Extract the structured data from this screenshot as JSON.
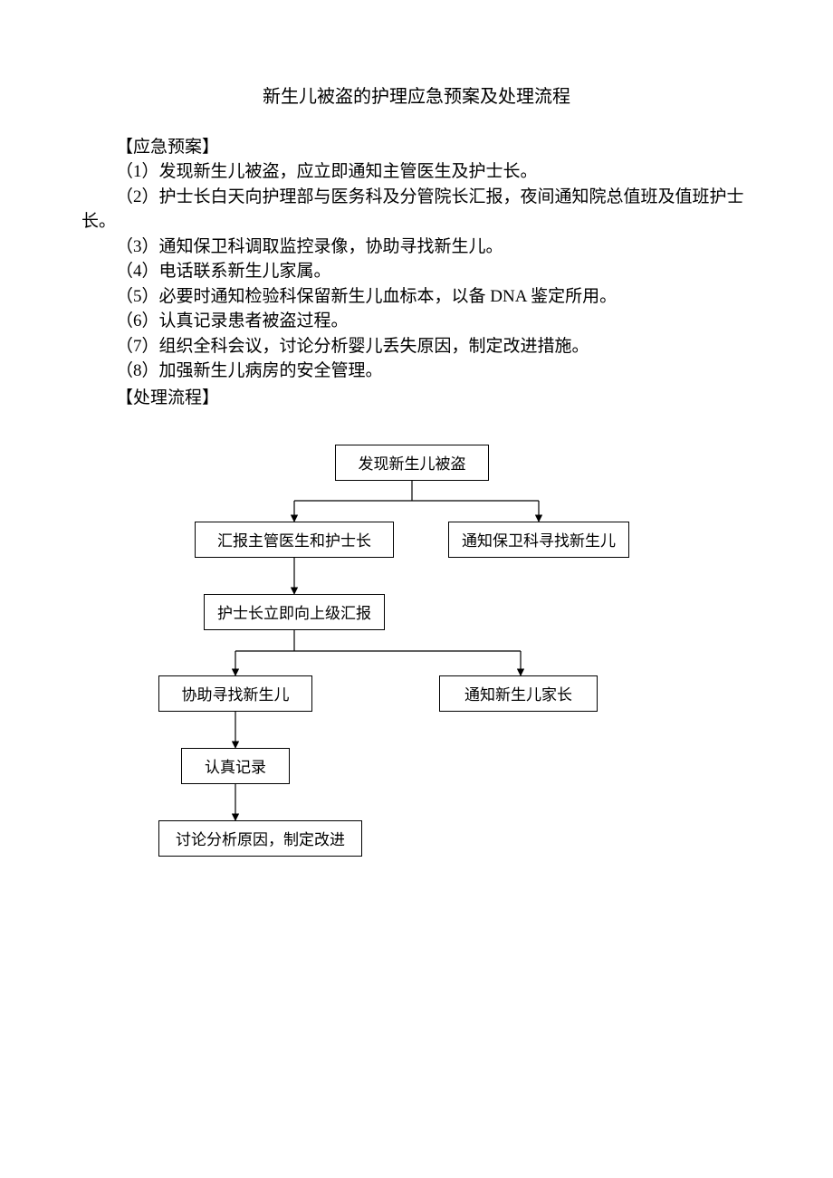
{
  "title": "新生儿被盗的护理应急预案及处理流程",
  "section1_label": "【应急预案】",
  "items": {
    "p1": "（1）发现新生儿被盗，应立即通知主管医生及护士长。",
    "p2": "（2）护士长白天向护理部与医务科及分管院长汇报，夜间通知院总值班及值班护士长。",
    "p3": "（3）通知保卫科调取监控录像，协助寻找新生儿。",
    "p4": "（4）电话联系新生儿家属。",
    "p5": "（5）必要时通知检验科保留新生儿血标本，以备 DNA 鉴定所用。",
    "p6": "（6）认真记录患者被盗过程。",
    "p7": "（7）组织全科会议，讨论分析婴儿丢失原因，制定改进措施。",
    "p8": "（8）加强新生儿病房的安全管理。"
  },
  "section2_label": "【处理流程】",
  "flow": {
    "b1": "发现新生儿被盗",
    "b2": "汇报主管医生和护士长",
    "b3": "通知保卫科寻找新生儿",
    "b4": "护士长立即向上级汇报",
    "b5": "协助寻找新生儿",
    "b6": "通知新生儿家长",
    "b7": "认真记录",
    "b8": "讨论分析原因，制定改进"
  }
}
